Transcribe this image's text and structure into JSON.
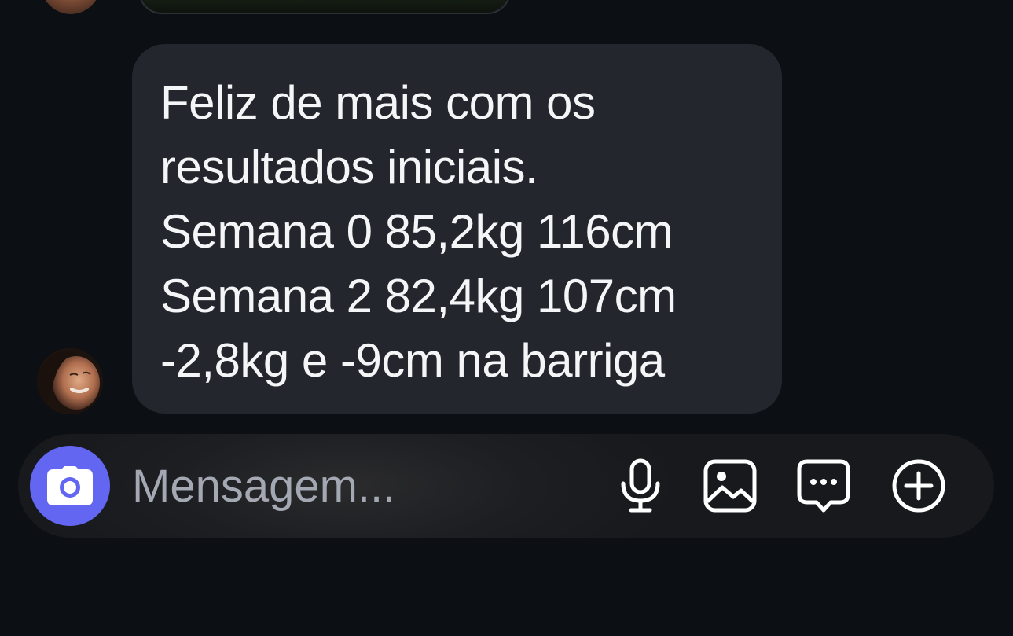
{
  "top_partial": {
    "avatar_icon": "user-avatar",
    "media_icon": "photo-thumbnail"
  },
  "message": {
    "avatar_icon": "user-avatar",
    "lines": [
      "Feliz de mais com os",
      "resultados iniciais.",
      "Semana 0 85,2kg 116cm",
      "Semana 2 82,4kg 107cm",
      "-2,8kg e -9cm na barriga"
    ],
    "bubble_color": "#23262c"
  },
  "composer": {
    "placeholder": "Mensagem...",
    "value": "",
    "camera_icon": "camera-icon",
    "camera_color": "#6366f1",
    "tools": [
      "microphone-icon",
      "image-icon",
      "sticker-chat-icon",
      "add-circle-icon"
    ]
  }
}
